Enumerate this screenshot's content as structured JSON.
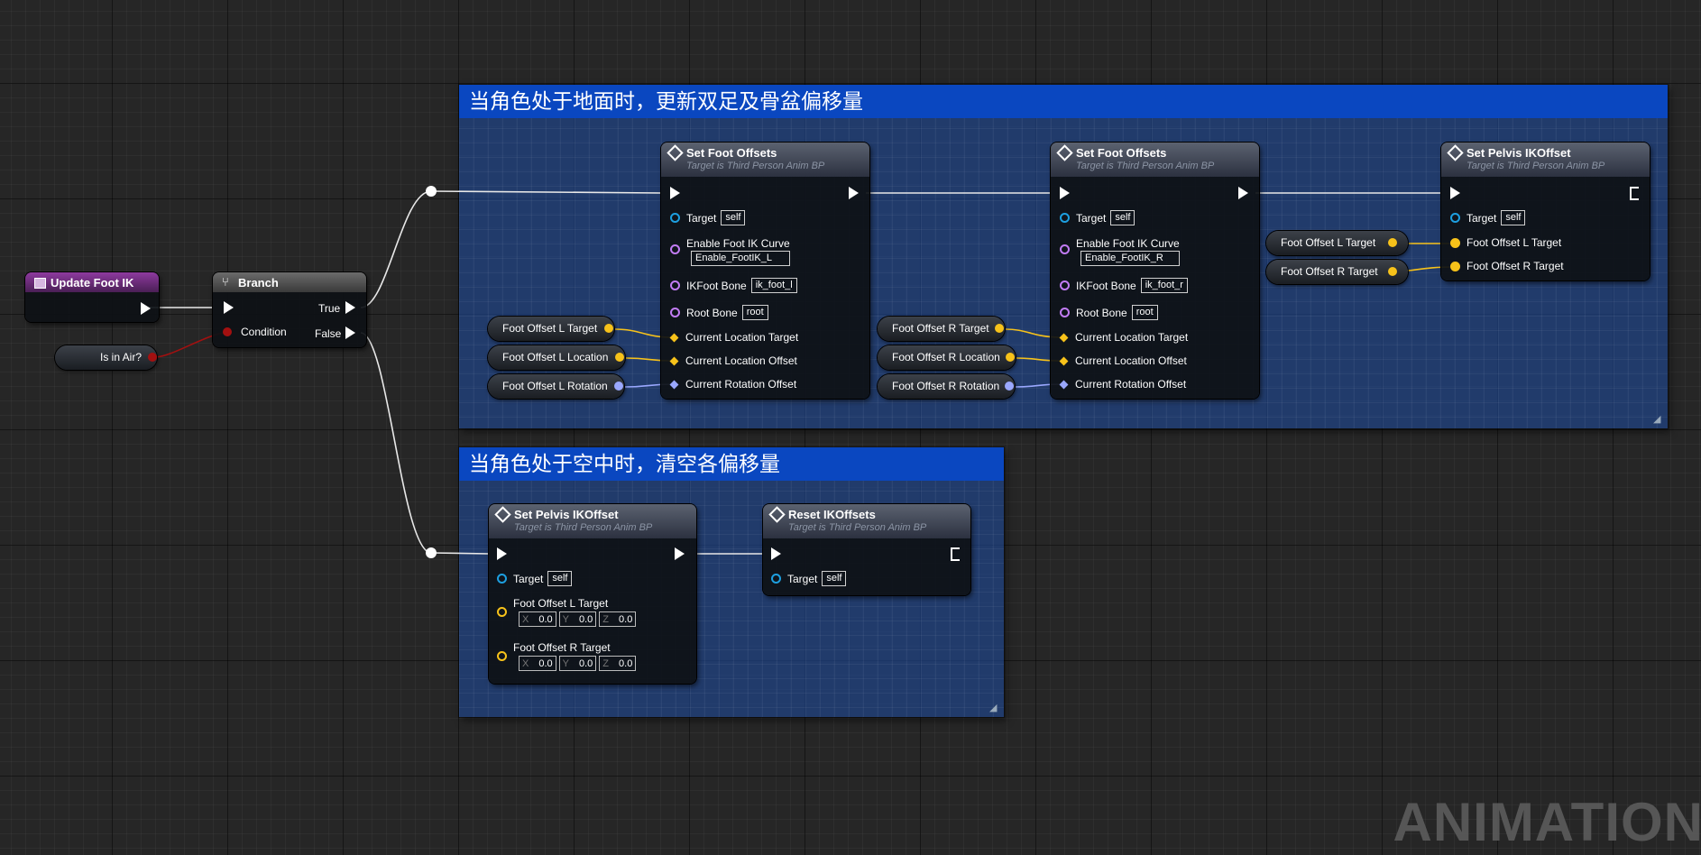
{
  "comments": {
    "ground": "当角色处于地面时，更新双足及骨盆偏移量",
    "air": "当角色处于空中时，清空各偏移量"
  },
  "event_node": {
    "title": "Update Foot IK"
  },
  "branch_node": {
    "title": "Branch",
    "condition": "Condition",
    "true_label": "True",
    "false_label": "False"
  },
  "is_in_air_var": "Is in Air?",
  "set_foot_offsets_l": {
    "title": "Set Foot Offsets",
    "subtitle": "Target is Third Person Anim BP",
    "target_label": "Target",
    "target_value": "self",
    "curve_label": "Enable Foot IK Curve",
    "curve_value": "Enable_FootIK_L",
    "bone_label": "IKFoot Bone",
    "bone_value": "ik_foot_l",
    "root_label": "Root Bone",
    "root_value": "root",
    "loc_target": "Current Location Target",
    "loc_offset": "Current Location Offset",
    "rot_offset": "Current Rotation Offset"
  },
  "set_foot_offsets_r": {
    "title": "Set Foot Offsets",
    "subtitle": "Target is Third Person Anim BP",
    "target_label": "Target",
    "target_value": "self",
    "curve_label": "Enable Foot IK Curve",
    "curve_value": "Enable_FootIK_R",
    "bone_label": "IKFoot Bone",
    "bone_value": "ik_foot_r",
    "root_label": "Root Bone",
    "root_value": "root",
    "loc_target": "Current Location Target",
    "loc_offset": "Current Location Offset",
    "rot_offset": "Current Rotation Offset"
  },
  "set_pelvis_top": {
    "title": "Set Pelvis IKOffset",
    "subtitle": "Target is Third Person Anim BP",
    "target_label": "Target",
    "target_value": "self",
    "l_target": "Foot Offset L Target",
    "r_target": "Foot Offset R Target"
  },
  "set_pelvis_air": {
    "title": "Set Pelvis IKOffset",
    "subtitle": "Target is Third Person Anim BP",
    "target_label": "Target",
    "target_value": "self",
    "l_target": "Foot Offset L Target",
    "r_target": "Foot Offset R Target",
    "x": "X",
    "y": "Y",
    "z": "Z",
    "zero": "0.0"
  },
  "reset_node": {
    "title": "Reset IKOffsets",
    "subtitle": "Target is Third Person Anim BP",
    "target_label": "Target",
    "target_value": "self"
  },
  "vars": {
    "l_target": "Foot Offset L Target",
    "l_location": "Foot Offset L Location",
    "l_rotation": "Foot Offset L Rotation",
    "r_target": "Foot Offset R Target",
    "r_location": "Foot Offset R Location",
    "r_rotation": "Foot Offset R Rotation",
    "pl_target": "Foot Offset L Target",
    "pr_target": "Foot Offset R Target"
  },
  "watermark": "ANIMATION",
  "colors": {
    "vector": "#f7c21a",
    "rotator": "#9aa8ff",
    "object": "#1d9fe0",
    "name": "#c27cf5",
    "bool": "#a31010",
    "comment": "#0a47c0"
  }
}
